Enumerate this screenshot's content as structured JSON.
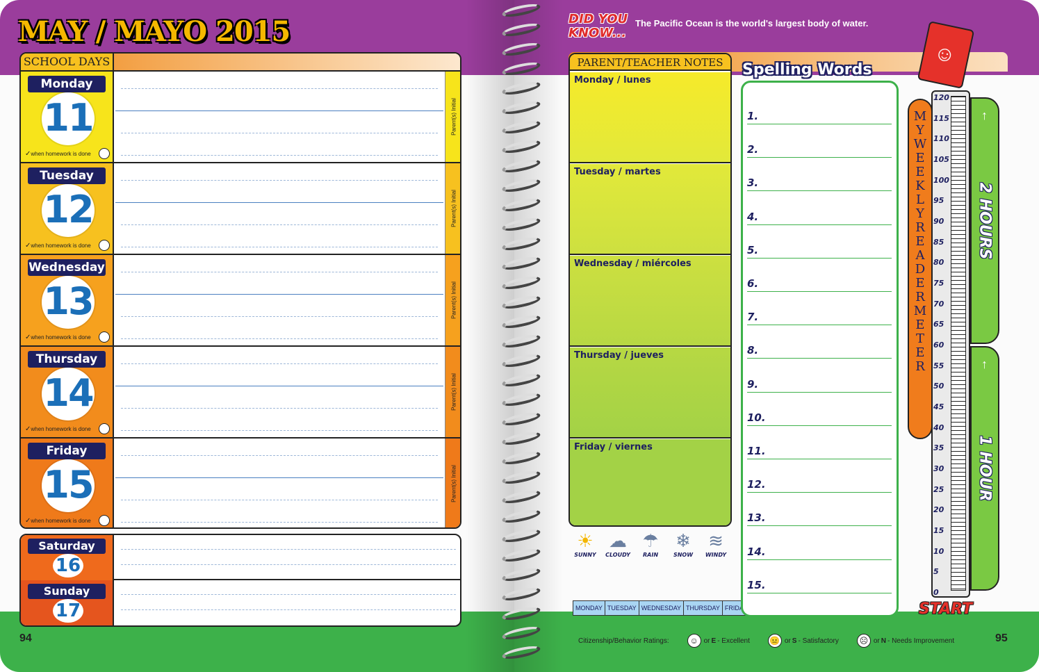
{
  "left_page": {
    "title": "MAY / MAYO 2015",
    "school_days_label": "SCHOOL DAYS",
    "homework_note": "when homework is done",
    "initial_label": "Parent(s) Initial",
    "page_number": "94",
    "days": [
      {
        "name": "Monday",
        "number": "11",
        "color": "#f7e41b"
      },
      {
        "name": "Tuesday",
        "number": "12",
        "color": "#f7c11f"
      },
      {
        "name": "Wednesday",
        "number": "13",
        "color": "#f6a11e"
      },
      {
        "name": "Thursday",
        "number": "14",
        "color": "#f28c1c"
      },
      {
        "name": "Friday",
        "number": "15",
        "color": "#ef7a1a"
      }
    ],
    "weekend": [
      {
        "name": "Saturday",
        "number": "16",
        "color": "#ef6a1c"
      },
      {
        "name": "Sunday",
        "number": "17",
        "color": "#e5551e"
      }
    ]
  },
  "right_page": {
    "did_you_know_label": "DID YOU KNOW...",
    "did_you_know_fact": "The Pacific Ocean is the world's largest body of water.",
    "notes_title": "PARENT/TEACHER NOTES",
    "notes_days": [
      "Monday / lunes",
      "Tuesday / martes",
      "Wednesday / miércoles",
      "Thursday / jueves",
      "Friday / viernes"
    ],
    "weather": [
      {
        "label": "SUNNY",
        "icon": "sun-icon",
        "glyph": "☀"
      },
      {
        "label": "CLOUDY",
        "icon": "cloud-icon",
        "glyph": "☁"
      },
      {
        "label": "RAIN",
        "icon": "rain-icon",
        "glyph": "☂"
      },
      {
        "label": "SNOW",
        "icon": "snow-icon",
        "glyph": "❄"
      },
      {
        "label": "WINDY",
        "icon": "wind-icon",
        "glyph": "≋"
      }
    ],
    "weekdays": [
      "MONDAY",
      "TUESDAY",
      "WEDNESDAY",
      "THURSDAY",
      "FRIDAY"
    ],
    "spelling_title": "Spelling Words",
    "spelling_numbers": [
      "1.",
      "2.",
      "3.",
      "4.",
      "5.",
      "6.",
      "7.",
      "8.",
      "9.",
      "10.",
      "11.",
      "12.",
      "13.",
      "14.",
      "15."
    ],
    "reader_meter_label": "MY WEEKLY READER METER",
    "meter_ticks": [
      "120",
      "115",
      "110",
      "105",
      "100",
      "95",
      "90",
      "85",
      "80",
      "75",
      "70",
      "65",
      "60",
      "55",
      "50",
      "45",
      "40",
      "35",
      "30",
      "25",
      "20",
      "15",
      "10",
      "5",
      "0"
    ],
    "hour_labels": [
      "2 HOURS",
      "1 HOUR"
    ],
    "start_label": "START",
    "ratings_label": "Citizenship/Behavior Ratings:",
    "ratings": [
      {
        "prefix": "or",
        "letter": "E",
        "text": "- Excellent",
        "face": "☺"
      },
      {
        "prefix": "or",
        "letter": "S",
        "text": "- Satisfactory",
        "face": "😐"
      },
      {
        "prefix": "or",
        "letter": "N",
        "text": "- Needs Improvement",
        "face": "☹"
      }
    ],
    "page_number": "95"
  },
  "colors": {
    "purple": "#9a3d9c",
    "green": "#3db14a",
    "navy": "#1e2060",
    "blue_number": "#1b6fb8",
    "orange": "#f07c1c"
  }
}
